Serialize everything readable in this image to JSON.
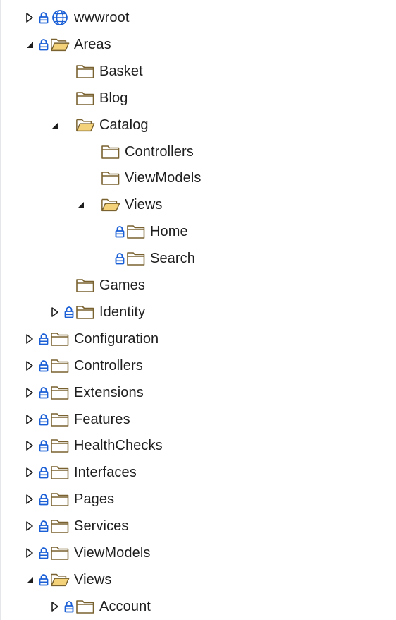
{
  "tree": {
    "rows": [
      {
        "label": "wwwroot",
        "depth": 0,
        "expander": "collapsed",
        "lock": true,
        "icon": "globe-icon"
      },
      {
        "label": "Areas",
        "depth": 0,
        "expander": "expanded",
        "lock": true,
        "icon": "folder-open-icon"
      },
      {
        "label": "Basket",
        "depth": 1,
        "expander": "none",
        "lock": false,
        "icon": "folder-icon"
      },
      {
        "label": "Blog",
        "depth": 1,
        "expander": "none",
        "lock": false,
        "icon": "folder-icon"
      },
      {
        "label": "Catalog",
        "depth": 1,
        "expander": "expanded",
        "lock": false,
        "icon": "folder-open-icon"
      },
      {
        "label": "Controllers",
        "depth": 2,
        "expander": "none",
        "lock": false,
        "icon": "folder-icon"
      },
      {
        "label": "ViewModels",
        "depth": 2,
        "expander": "none",
        "lock": false,
        "icon": "folder-icon"
      },
      {
        "label": "Views",
        "depth": 2,
        "expander": "expanded",
        "lock": false,
        "icon": "folder-open-icon"
      },
      {
        "label": "Home",
        "depth": 3,
        "expander": "none",
        "lock": true,
        "icon": "folder-icon"
      },
      {
        "label": "Search",
        "depth": 3,
        "expander": "none",
        "lock": true,
        "icon": "folder-icon"
      },
      {
        "label": "Games",
        "depth": 1,
        "expander": "none",
        "lock": false,
        "icon": "folder-icon"
      },
      {
        "label": "Identity",
        "depth": 1,
        "expander": "collapsed",
        "lock": true,
        "icon": "folder-icon"
      },
      {
        "label": "Configuration",
        "depth": 0,
        "expander": "collapsed",
        "lock": true,
        "icon": "folder-icon"
      },
      {
        "label": "Controllers",
        "depth": 0,
        "expander": "collapsed",
        "lock": true,
        "icon": "folder-icon"
      },
      {
        "label": "Extensions",
        "depth": 0,
        "expander": "collapsed",
        "lock": true,
        "icon": "folder-icon"
      },
      {
        "label": "Features",
        "depth": 0,
        "expander": "collapsed",
        "lock": true,
        "icon": "folder-icon"
      },
      {
        "label": "HealthChecks",
        "depth": 0,
        "expander": "collapsed",
        "lock": true,
        "icon": "folder-icon"
      },
      {
        "label": "Interfaces",
        "depth": 0,
        "expander": "collapsed",
        "lock": true,
        "icon": "folder-icon"
      },
      {
        "label": "Pages",
        "depth": 0,
        "expander": "collapsed",
        "lock": true,
        "icon": "folder-icon"
      },
      {
        "label": "Services",
        "depth": 0,
        "expander": "collapsed",
        "lock": true,
        "icon": "folder-icon"
      },
      {
        "label": "ViewModels",
        "depth": 0,
        "expander": "collapsed",
        "lock": true,
        "icon": "folder-icon"
      },
      {
        "label": "Views",
        "depth": 0,
        "expander": "expanded",
        "lock": true,
        "icon": "folder-open-icon"
      },
      {
        "label": "Account",
        "depth": 1,
        "expander": "collapsed",
        "lock": true,
        "icon": "folder-icon"
      }
    ]
  },
  "colors": {
    "lock": "#1a5fd6",
    "globe": "#1a5fd6",
    "folder_stroke": "#7a6230",
    "folder_fill": "#ffffff",
    "folder_open_fill": "#f3d27a",
    "expander": "#1e1e1e",
    "text": "#1e1e1e"
  }
}
